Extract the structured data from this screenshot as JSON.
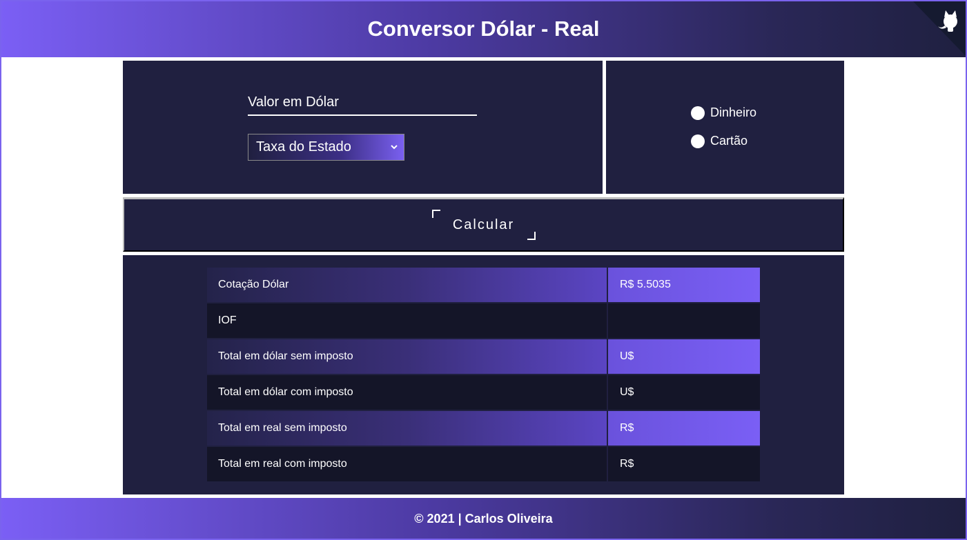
{
  "header": {
    "title": "Conversor Dólar - Real",
    "corner_icon": "github-octocat-icon"
  },
  "form": {
    "dollar_placeholder": "Valor em Dólar",
    "dollar_value": "",
    "state_select_label": "Taxa do Estado"
  },
  "payment": {
    "options": [
      "Dinheiro",
      "Cartão"
    ]
  },
  "actions": {
    "calculate_label": "Calcular"
  },
  "results": {
    "rows": [
      {
        "label": "Cotação Dólar",
        "value": "R$ 5.5035"
      },
      {
        "label": "IOF",
        "value": ""
      },
      {
        "label": "Total em dólar sem imposto",
        "value": "U$"
      },
      {
        "label": "Total em dólar com imposto",
        "value": "U$"
      },
      {
        "label": "Total em real sem imposto",
        "value": "R$"
      },
      {
        "label": "Total em real com imposto",
        "value": "R$"
      }
    ]
  },
  "footer": {
    "text": "© 2021 | Carlos Oliveira"
  },
  "colors": {
    "accent": "#7b5ff5",
    "panel": "#202040",
    "dark_row": "#141528"
  }
}
